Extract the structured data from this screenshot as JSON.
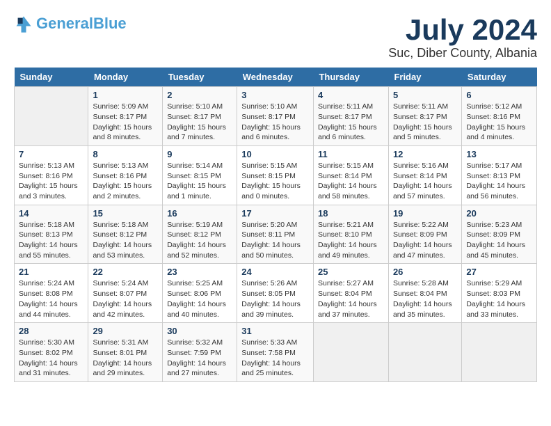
{
  "logo": {
    "line1": "General",
    "line2": "Blue"
  },
  "title": "July 2024",
  "subtitle": "Suc, Diber County, Albania",
  "days_header": [
    "Sunday",
    "Monday",
    "Tuesday",
    "Wednesday",
    "Thursday",
    "Friday",
    "Saturday"
  ],
  "weeks": [
    [
      {
        "day": "",
        "info": ""
      },
      {
        "day": "1",
        "info": "Sunrise: 5:09 AM\nSunset: 8:17 PM\nDaylight: 15 hours\nand 8 minutes."
      },
      {
        "day": "2",
        "info": "Sunrise: 5:10 AM\nSunset: 8:17 PM\nDaylight: 15 hours\nand 7 minutes."
      },
      {
        "day": "3",
        "info": "Sunrise: 5:10 AM\nSunset: 8:17 PM\nDaylight: 15 hours\nand 6 minutes."
      },
      {
        "day": "4",
        "info": "Sunrise: 5:11 AM\nSunset: 8:17 PM\nDaylight: 15 hours\nand 6 minutes."
      },
      {
        "day": "5",
        "info": "Sunrise: 5:11 AM\nSunset: 8:17 PM\nDaylight: 15 hours\nand 5 minutes."
      },
      {
        "day": "6",
        "info": "Sunrise: 5:12 AM\nSunset: 8:16 PM\nDaylight: 15 hours\nand 4 minutes."
      }
    ],
    [
      {
        "day": "7",
        "info": "Sunrise: 5:13 AM\nSunset: 8:16 PM\nDaylight: 15 hours\nand 3 minutes."
      },
      {
        "day": "8",
        "info": "Sunrise: 5:13 AM\nSunset: 8:16 PM\nDaylight: 15 hours\nand 2 minutes."
      },
      {
        "day": "9",
        "info": "Sunrise: 5:14 AM\nSunset: 8:15 PM\nDaylight: 15 hours\nand 1 minute."
      },
      {
        "day": "10",
        "info": "Sunrise: 5:15 AM\nSunset: 8:15 PM\nDaylight: 15 hours\nand 0 minutes."
      },
      {
        "day": "11",
        "info": "Sunrise: 5:15 AM\nSunset: 8:14 PM\nDaylight: 14 hours\nand 58 minutes."
      },
      {
        "day": "12",
        "info": "Sunrise: 5:16 AM\nSunset: 8:14 PM\nDaylight: 14 hours\nand 57 minutes."
      },
      {
        "day": "13",
        "info": "Sunrise: 5:17 AM\nSunset: 8:13 PM\nDaylight: 14 hours\nand 56 minutes."
      }
    ],
    [
      {
        "day": "14",
        "info": "Sunrise: 5:18 AM\nSunset: 8:13 PM\nDaylight: 14 hours\nand 55 minutes."
      },
      {
        "day": "15",
        "info": "Sunrise: 5:18 AM\nSunset: 8:12 PM\nDaylight: 14 hours\nand 53 minutes."
      },
      {
        "day": "16",
        "info": "Sunrise: 5:19 AM\nSunset: 8:12 PM\nDaylight: 14 hours\nand 52 minutes."
      },
      {
        "day": "17",
        "info": "Sunrise: 5:20 AM\nSunset: 8:11 PM\nDaylight: 14 hours\nand 50 minutes."
      },
      {
        "day": "18",
        "info": "Sunrise: 5:21 AM\nSunset: 8:10 PM\nDaylight: 14 hours\nand 49 minutes."
      },
      {
        "day": "19",
        "info": "Sunrise: 5:22 AM\nSunset: 8:09 PM\nDaylight: 14 hours\nand 47 minutes."
      },
      {
        "day": "20",
        "info": "Sunrise: 5:23 AM\nSunset: 8:09 PM\nDaylight: 14 hours\nand 45 minutes."
      }
    ],
    [
      {
        "day": "21",
        "info": "Sunrise: 5:24 AM\nSunset: 8:08 PM\nDaylight: 14 hours\nand 44 minutes."
      },
      {
        "day": "22",
        "info": "Sunrise: 5:24 AM\nSunset: 8:07 PM\nDaylight: 14 hours\nand 42 minutes."
      },
      {
        "day": "23",
        "info": "Sunrise: 5:25 AM\nSunset: 8:06 PM\nDaylight: 14 hours\nand 40 minutes."
      },
      {
        "day": "24",
        "info": "Sunrise: 5:26 AM\nSunset: 8:05 PM\nDaylight: 14 hours\nand 39 minutes."
      },
      {
        "day": "25",
        "info": "Sunrise: 5:27 AM\nSunset: 8:04 PM\nDaylight: 14 hours\nand 37 minutes."
      },
      {
        "day": "26",
        "info": "Sunrise: 5:28 AM\nSunset: 8:04 PM\nDaylight: 14 hours\nand 35 minutes."
      },
      {
        "day": "27",
        "info": "Sunrise: 5:29 AM\nSunset: 8:03 PM\nDaylight: 14 hours\nand 33 minutes."
      }
    ],
    [
      {
        "day": "28",
        "info": "Sunrise: 5:30 AM\nSunset: 8:02 PM\nDaylight: 14 hours\nand 31 minutes."
      },
      {
        "day": "29",
        "info": "Sunrise: 5:31 AM\nSunset: 8:01 PM\nDaylight: 14 hours\nand 29 minutes."
      },
      {
        "day": "30",
        "info": "Sunrise: 5:32 AM\nSunset: 7:59 PM\nDaylight: 14 hours\nand 27 minutes."
      },
      {
        "day": "31",
        "info": "Sunrise: 5:33 AM\nSunset: 7:58 PM\nDaylight: 14 hours\nand 25 minutes."
      },
      {
        "day": "",
        "info": ""
      },
      {
        "day": "",
        "info": ""
      },
      {
        "day": "",
        "info": ""
      }
    ]
  ]
}
